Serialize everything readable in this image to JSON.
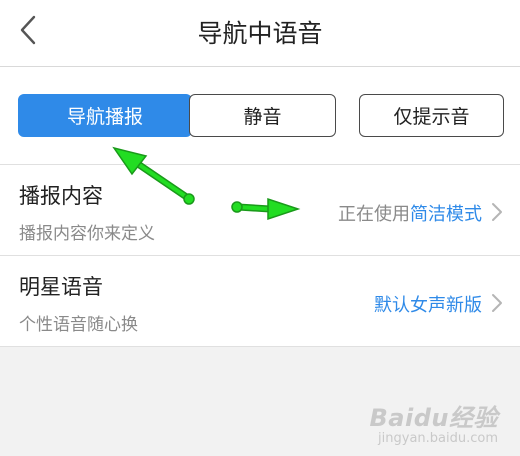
{
  "header": {
    "title": "导航中语音",
    "back_icon": "chevron-left-icon"
  },
  "modes": {
    "items": [
      "导航播报",
      "静音",
      "仅提示音"
    ],
    "selected": "导航播报"
  },
  "rows": [
    {
      "title": "播报内容",
      "subtitle": "播报内容你来定义",
      "value_prefix": "正在使用",
      "value": "简洁模式"
    },
    {
      "title": "明星语音",
      "subtitle": "个性语音随心换",
      "value_prefix": "",
      "value": "默认女声新版"
    }
  ],
  "watermark": {
    "logo": "Baidu经验",
    "site": "jingyan.baidu.com"
  },
  "colors": {
    "accent": "#2f8ae8",
    "annotation_arrow": "#22dd22"
  }
}
